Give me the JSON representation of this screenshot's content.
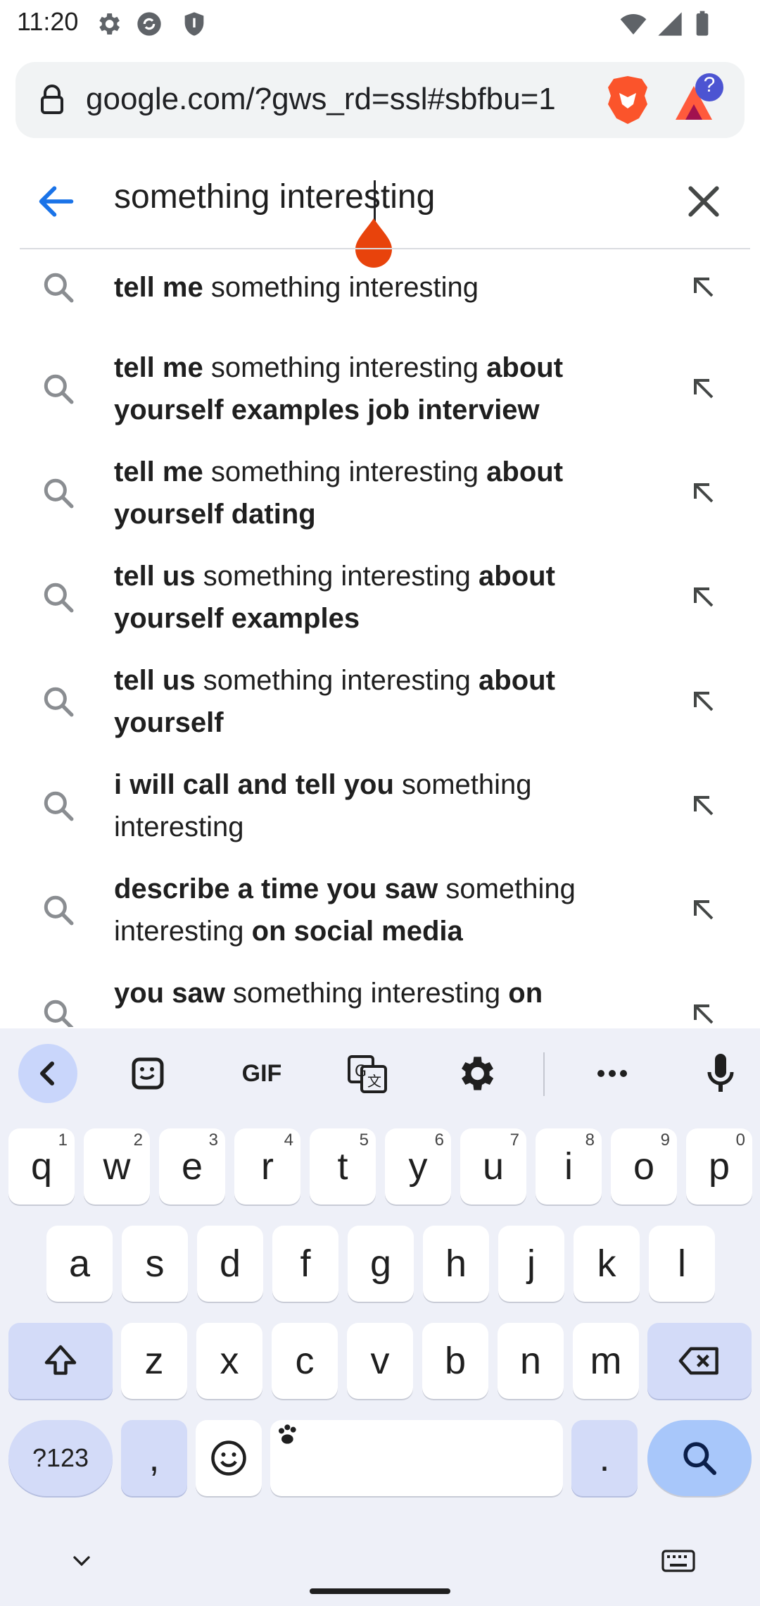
{
  "status_bar": {
    "time": "11:20"
  },
  "browser": {
    "url": "google.com/?gws_rd=ssl#sbfbu=1",
    "rewards_badge": "?"
  },
  "search": {
    "query": "something interesting"
  },
  "suggestions": [
    {
      "parts": [
        {
          "t": "tell me",
          "b": true
        },
        {
          "t": " something interesting",
          "b": false
        }
      ]
    },
    {
      "parts": [
        {
          "t": "tell me",
          "b": true
        },
        {
          "t": " something interesting ",
          "b": false
        },
        {
          "t": "about yourself examples job interview",
          "b": true
        }
      ]
    },
    {
      "parts": [
        {
          "t": "tell me",
          "b": true
        },
        {
          "t": " something interesting ",
          "b": false
        },
        {
          "t": "about yourself dating",
          "b": true
        }
      ]
    },
    {
      "parts": [
        {
          "t": "tell us",
          "b": true
        },
        {
          "t": " something interesting ",
          "b": false
        },
        {
          "t": "about yourself examples",
          "b": true
        }
      ]
    },
    {
      "parts": [
        {
          "t": "tell us",
          "b": true
        },
        {
          "t": " something interesting ",
          "b": false
        },
        {
          "t": "about yourself",
          "b": true
        }
      ]
    },
    {
      "parts": [
        {
          "t": "i will call and tell you",
          "b": true
        },
        {
          "t": " something interesting",
          "b": false
        }
      ]
    },
    {
      "parts": [
        {
          "t": "describe a time you saw",
          "b": true
        },
        {
          "t": " something interesting ",
          "b": false
        },
        {
          "t": "on social media",
          "b": true
        }
      ]
    },
    {
      "parts": [
        {
          "t": "you saw",
          "b": true
        },
        {
          "t": " something interesting ",
          "b": false
        },
        {
          "t": "on",
          "b": true
        }
      ]
    }
  ],
  "keyboard": {
    "toolbar": {
      "gif_label": "GIF"
    },
    "row1": [
      {
        "k": "q",
        "h": "1"
      },
      {
        "k": "w",
        "h": "2"
      },
      {
        "k": "e",
        "h": "3"
      },
      {
        "k": "r",
        "h": "4"
      },
      {
        "k": "t",
        "h": "5"
      },
      {
        "k": "y",
        "h": "6"
      },
      {
        "k": "u",
        "h": "7"
      },
      {
        "k": "i",
        "h": "8"
      },
      {
        "k": "o",
        "h": "9"
      },
      {
        "k": "p",
        "h": "0"
      }
    ],
    "row2": [
      "a",
      "s",
      "d",
      "f",
      "g",
      "h",
      "j",
      "k",
      "l"
    ],
    "row3": [
      "z",
      "x",
      "c",
      "v",
      "b",
      "n",
      "m"
    ],
    "symbols_label": "?123",
    "comma_label": ",",
    "period_label": "."
  },
  "colors": {
    "accent_blue": "#1a73e8",
    "brave_orange": "#fb542b",
    "cursor_handle": "#e53935",
    "keyboard_bg": "#eef0f8",
    "modifier_key": "#d3dbf8",
    "search_key": "#a8c7fa"
  }
}
